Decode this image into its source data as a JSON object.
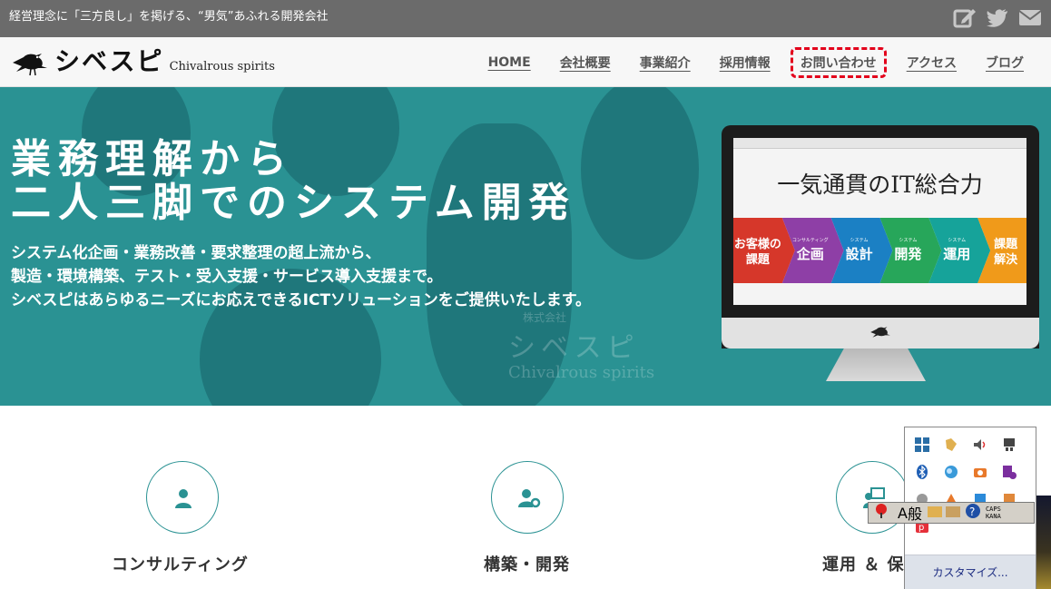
{
  "topbar": {
    "tagline": "経営理念に「三方良し」を掲げる、“男気”あふれる開発会社",
    "icons": [
      "edit-icon",
      "twitter-icon",
      "mail-icon"
    ]
  },
  "header": {
    "brand": "シベスピ",
    "brand_sub": "Chivalrous spirits",
    "nav": [
      "HOME",
      "会社概要",
      "事業紹介",
      "採用情報",
      "お問い合わせ",
      "アクセス",
      "ブログ"
    ]
  },
  "hero": {
    "headline_1": "業務理解から",
    "headline_2": "二人三脚でのシステム開発",
    "desc_1": "システム化企画・業務改善・要求整理の超上流から、",
    "desc_2": "製造・環境構築、テスト・受入支援・サービス導入支援まで。",
    "desc_3": "シベスピはあらゆるニーズにお応えできるICTソリューションをご提供いたします。",
    "watermark_1": "株式会社",
    "watermark_2": "シベスピ",
    "watermark_3": "Chivalrous spirits",
    "screen_title": "一気通貫のIT総合力",
    "steps": [
      {
        "small": "",
        "label": "お客様の課題",
        "color": "#d6372a"
      },
      {
        "small": "コンサルティング",
        "label": "企画",
        "color": "#8e3fa6"
      },
      {
        "small": "システム",
        "label": "設計",
        "color": "#1b80c4"
      },
      {
        "small": "システム",
        "label": "開発",
        "color": "#27a65a"
      },
      {
        "small": "システム",
        "label": "運用",
        "color": "#16a39a"
      },
      {
        "small": "",
        "label": "課題解決",
        "color": "#f09a1a"
      }
    ]
  },
  "services": [
    {
      "title": "コンサルティング",
      "icon": "person-icon"
    },
    {
      "title": "構築・開発",
      "icon": "user-gear-icon"
    },
    {
      "title": "運用 ＆ 保",
      "icon": "presenter-icon"
    }
  ],
  "tray": {
    "customize": "カスタマイズ...",
    "ime_mode": "A",
    "ime_kanji": "般",
    "caps": "CAPS",
    "kana": "KANA"
  },
  "colors": {
    "accent": "#2a9293",
    "highlight": "#e3001b",
    "topbar": "#6b6b6b"
  }
}
